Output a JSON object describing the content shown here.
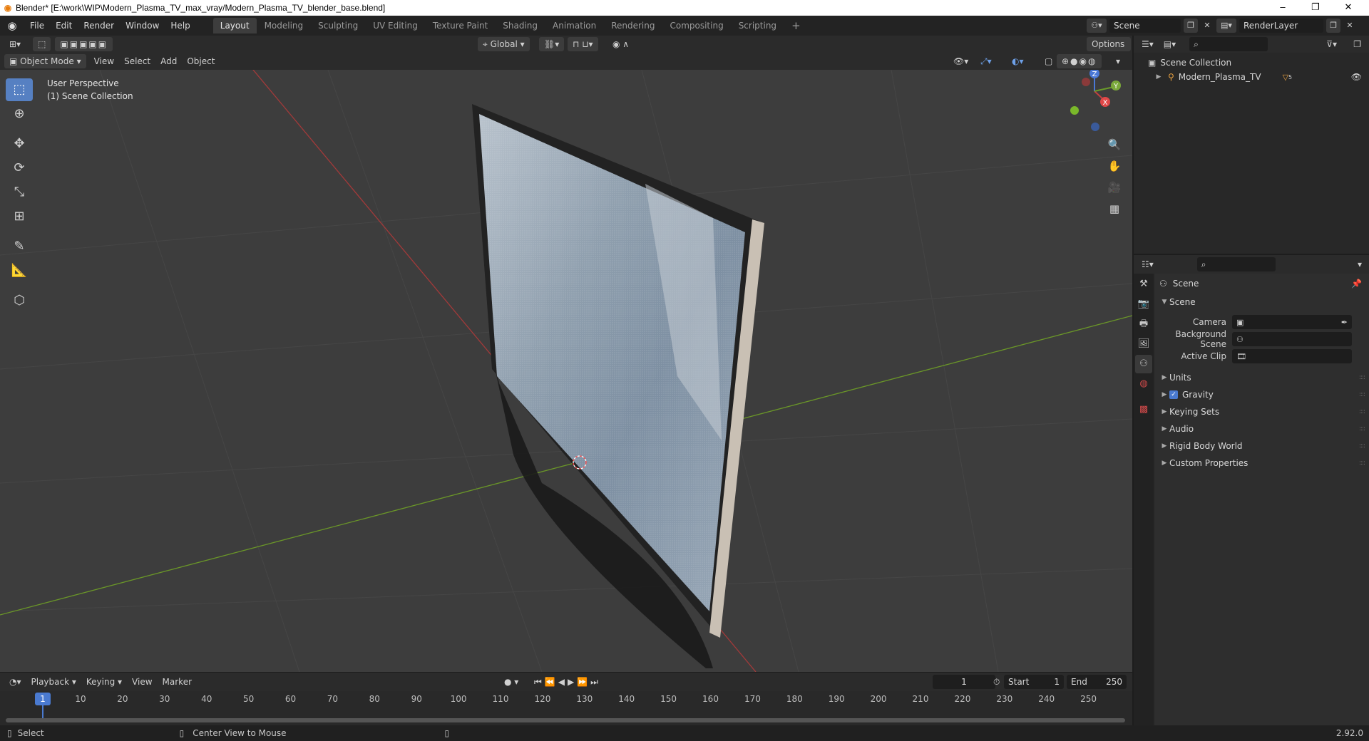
{
  "window": {
    "title": "Blender* [E:\\work\\WIP\\Modern_Plasma_TV_max_vray/Modern_Plasma_TV_blender_base.blend]",
    "minimize": "–",
    "restore": "❐",
    "close": "✕"
  },
  "menus": [
    "File",
    "Edit",
    "Render",
    "Window",
    "Help"
  ],
  "workspaces": [
    "Layout",
    "Modeling",
    "Sculpting",
    "UV Editing",
    "Texture Paint",
    "Shading",
    "Animation",
    "Rendering",
    "Compositing",
    "Scripting"
  ],
  "scene_field": "Scene",
  "renderlayer_field": "RenderLayer",
  "viewport": {
    "transform_orientation": "Global",
    "options_label": "Options",
    "mode": "Object Mode",
    "menu": [
      "View",
      "Select",
      "Add",
      "Object"
    ],
    "info_line1": "User Perspective",
    "info_line2": "(1) Scene Collection",
    "gizmo": {
      "x": "X",
      "y": "Y",
      "z": "Z"
    }
  },
  "timeline": {
    "menu": [
      "Playback",
      "Keying",
      "View",
      "Marker"
    ],
    "current_frame": "1",
    "start_label": "Start",
    "start_value": "1",
    "end_label": "End",
    "end_value": "250",
    "ticks": [
      "1",
      "10",
      "20",
      "30",
      "40",
      "50",
      "60",
      "70",
      "80",
      "90",
      "100",
      "110",
      "120",
      "130",
      "140",
      "150",
      "160",
      "170",
      "180",
      "190",
      "200",
      "210",
      "220",
      "230",
      "240",
      "250"
    ]
  },
  "status": {
    "select": "Select",
    "center_view": "Center View to Mouse",
    "version": "2.92.0"
  },
  "outliner": {
    "root": "Scene Collection",
    "items": [
      {
        "name": "Modern_Plasma_TV",
        "badge": "5"
      }
    ]
  },
  "properties": {
    "context_title": "Scene",
    "panel_title": "Scene",
    "fields": [
      {
        "label": "Camera",
        "value": ""
      },
      {
        "label": "Background Scene",
        "value": ""
      },
      {
        "label": "Active Clip",
        "value": ""
      }
    ],
    "subpanels": [
      "Units",
      "Gravity",
      "Keying Sets",
      "Audio",
      "Rigid Body World",
      "Custom Properties"
    ],
    "gravity_checked": true
  },
  "colors": {
    "accent": "#4a7ad0",
    "x_axis": "#b33b3b",
    "y_axis": "#6a9a2a",
    "viewport_bg": "#3d3d3d"
  }
}
